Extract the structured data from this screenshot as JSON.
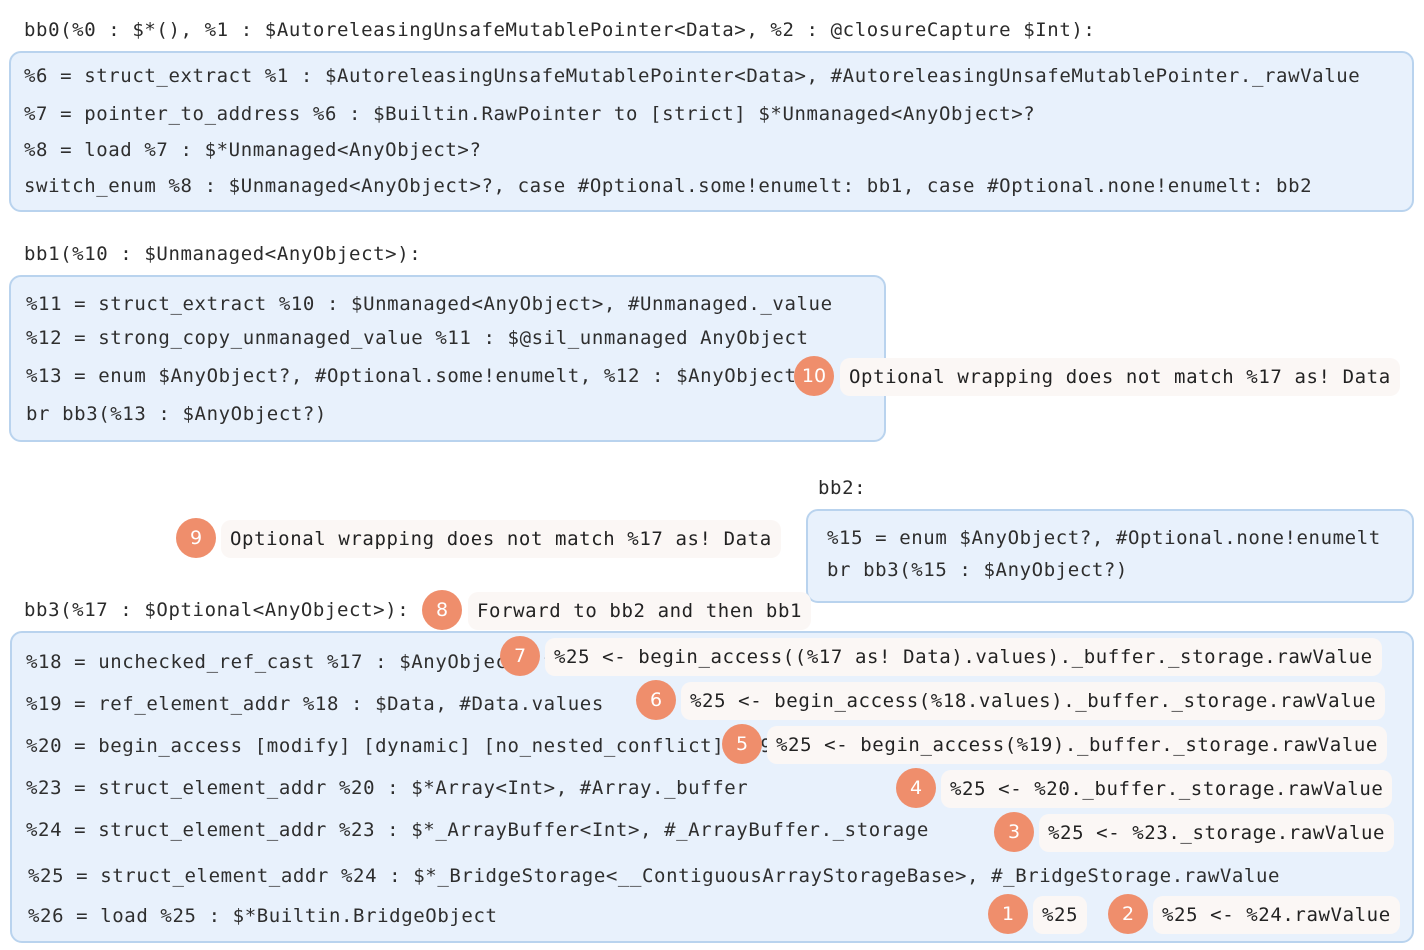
{
  "blocks": {
    "bb0": {
      "header": "bb0(%0 : $*(), %1 : $AutoreleasingUnsafeMutablePointer<Data>, %2 : @closureCapture $Int):",
      "lines": [
        "%6 = struct_extract %1 : $AutoreleasingUnsafeMutablePointer<Data>, #AutoreleasingUnsafeMutablePointer._rawValue",
        "%7 = pointer_to_address %6 : $Builtin.RawPointer to [strict] $*Unmanaged<AnyObject>?",
        "%8 = load %7 : $*Unmanaged<AnyObject>?",
        "switch_enum %8 : $Unmanaged<AnyObject>?, case #Optional.some!enumelt: bb1, case #Optional.none!enumelt: bb2"
      ]
    },
    "bb1": {
      "header": "bb1(%10 : $Unmanaged<AnyObject>):",
      "lines": [
        "%11 = struct_extract %10 : $Unmanaged<AnyObject>, #Unmanaged._value",
        "%12 = strong_copy_unmanaged_value %11 : $@sil_unmanaged AnyObject",
        "%13 = enum $AnyObject?, #Optional.some!enumelt, %12 : $AnyObject",
        "br bb3(%13 : $AnyObject?)"
      ]
    },
    "bb2": {
      "header": "bb2:",
      "lines": [
        "%15 = enum $AnyObject?, #Optional.none!enumelt",
        "br bb3(%15 : $AnyObject?)"
      ]
    },
    "bb3": {
      "header": "bb3(%17 : $Optional<AnyObject>):",
      "lines": [
        "%18 = unchecked_ref_cast %17 : $AnyObject? to $Data",
        "%19 = ref_element_addr %18 : $Data, #Data.values",
        "%20 = begin_access [modify] [dynamic] [no_nested_conflict] %19",
        "%23 = struct_element_addr %20 : $*Array<Int>, #Array._buffer",
        "%24 = struct_element_addr %23 : $*_ArrayBuffer<Int>, #_ArrayBuffer._storage",
        "%25 = struct_element_addr %24 : $*_BridgeStorage<__ContiguousArrayStorageBase>, #_BridgeStorage.rawValue",
        "%26 = load %25 : $*Builtin.BridgeObject"
      ]
    }
  },
  "annotations": [
    {
      "num": "1",
      "text": "%25"
    },
    {
      "num": "2",
      "text": "%25 <- %24.rawValue"
    },
    {
      "num": "3",
      "text": "%25 <- %23._storage.rawValue"
    },
    {
      "num": "4",
      "text": "%25 <- %20._buffer._storage.rawValue"
    },
    {
      "num": "5",
      "text": "%25 <- begin_access(%19)._buffer._storage.rawValue"
    },
    {
      "num": "6",
      "text": "%25 <- begin_access(%18.values)._buffer._storage.rawValue"
    },
    {
      "num": "7",
      "text": "%25 <- begin_access((%17 as! Data).values)._buffer._storage.rawValue"
    },
    {
      "num": "8",
      "text": "Forward to bb2 and then bb1"
    },
    {
      "num": "9",
      "text": "Optional wrapping does not match %17 as! Data"
    },
    {
      "num": "10",
      "text": "Optional wrapping does not match %17 as! Data"
    }
  ]
}
